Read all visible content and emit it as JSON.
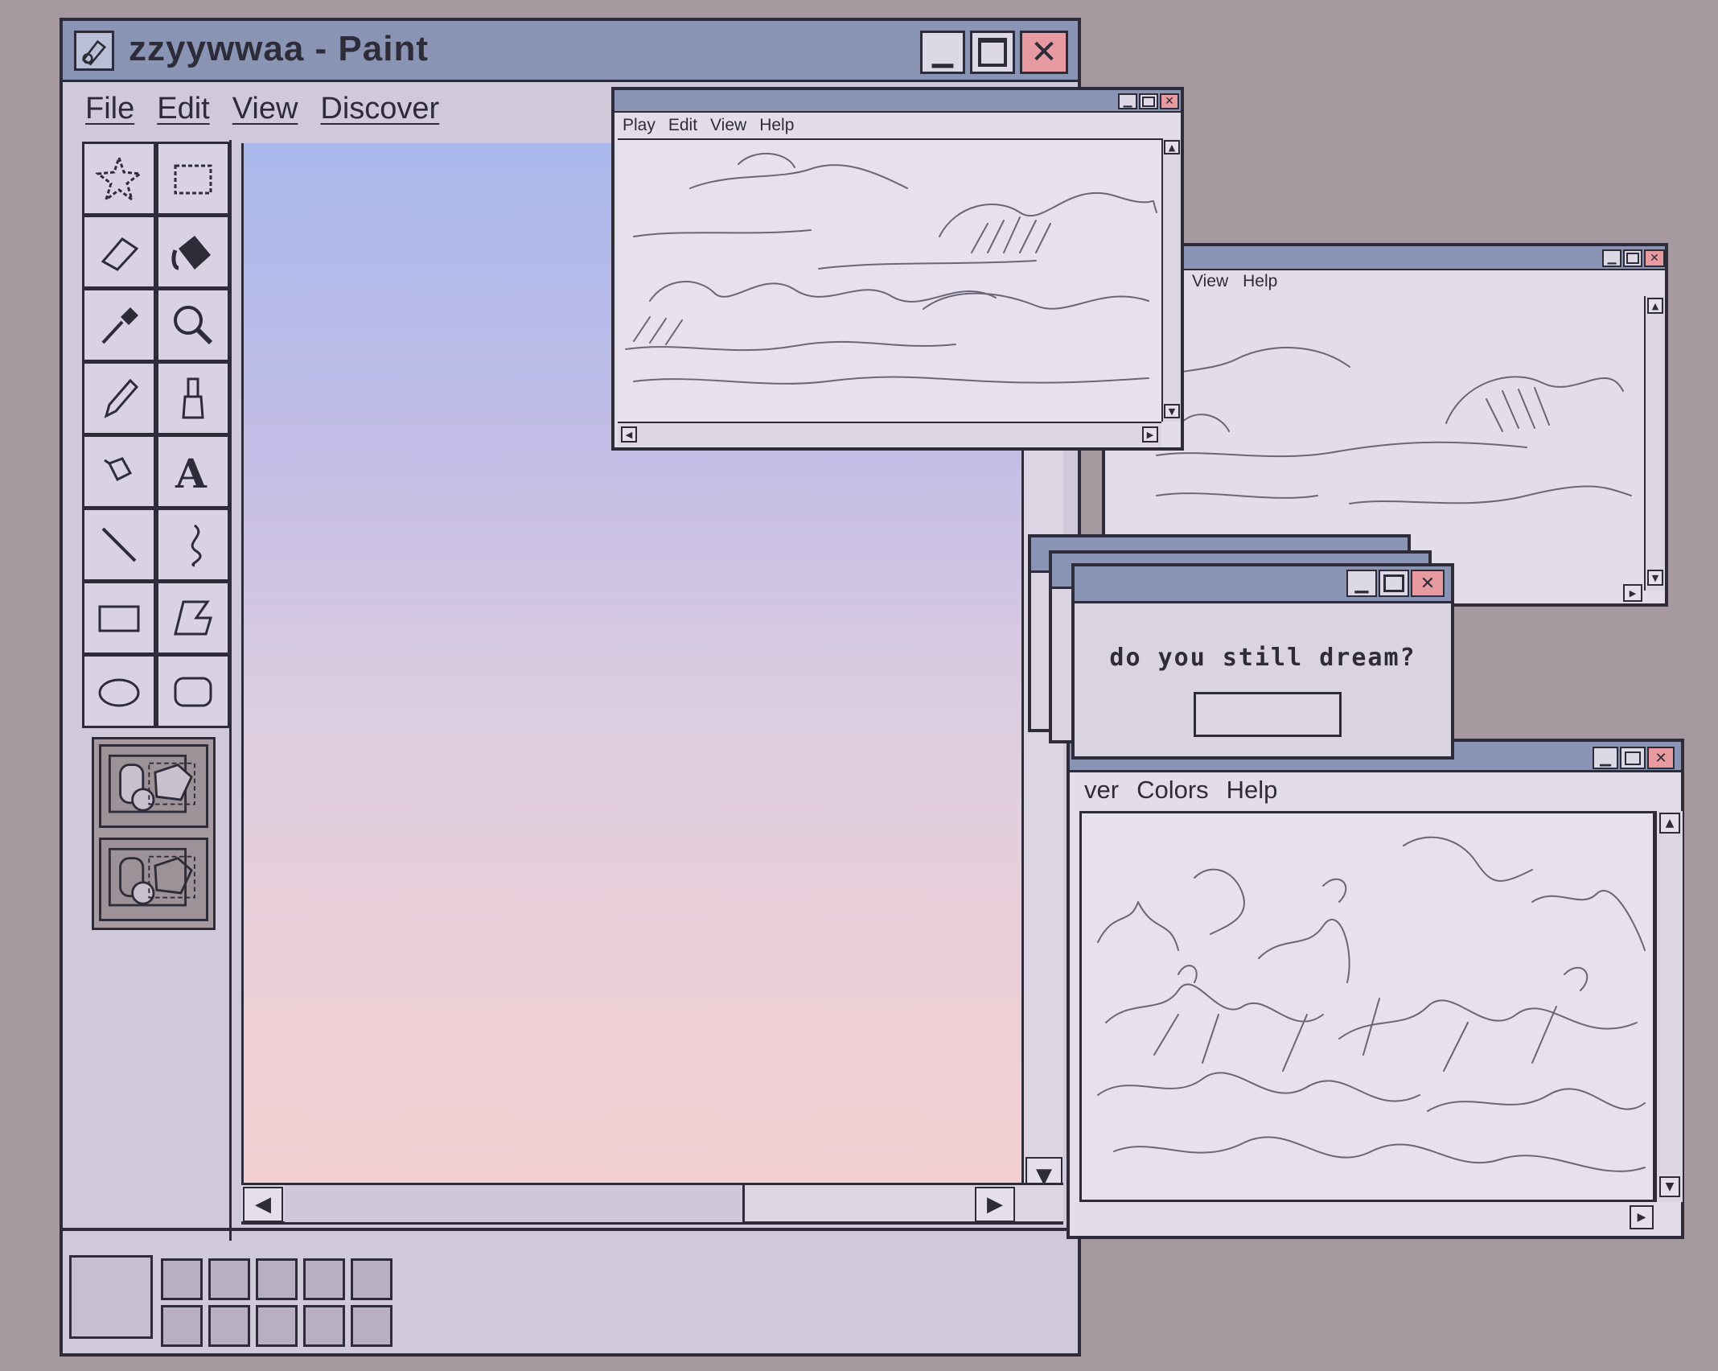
{
  "paint": {
    "title": "zzyywwaa - Paint",
    "menu": [
      "File",
      "Edit",
      "View",
      "Discover"
    ]
  },
  "window_play": {
    "menu": [
      "Play",
      "Edit",
      "View",
      "Help"
    ]
  },
  "window_view": {
    "menu": [
      "View",
      "Help"
    ]
  },
  "window_colors": {
    "menu": [
      "ver",
      "Colors",
      "Help"
    ]
  },
  "dialog": {
    "message": "do you still dream?",
    "button_label": ""
  },
  "colors": {
    "background": "#a69aa0",
    "titlebar": "#8a95b6",
    "window": "#d6d0e0",
    "close_button": "#e79aa0",
    "canvas_top": "#a9b9ec",
    "canvas_bottom": "#f2d0d2"
  },
  "icons": {
    "tools": [
      "free-select-icon",
      "rect-select-icon",
      "eraser-icon",
      "fill-bucket-icon",
      "color-picker-icon",
      "magnifier-icon",
      "pencil-icon",
      "brush-icon",
      "airbrush-icon",
      "text-icon",
      "line-icon",
      "curve-icon",
      "rectangle-icon",
      "polygon-icon",
      "ellipse-icon",
      "rounded-rect-icon"
    ]
  }
}
